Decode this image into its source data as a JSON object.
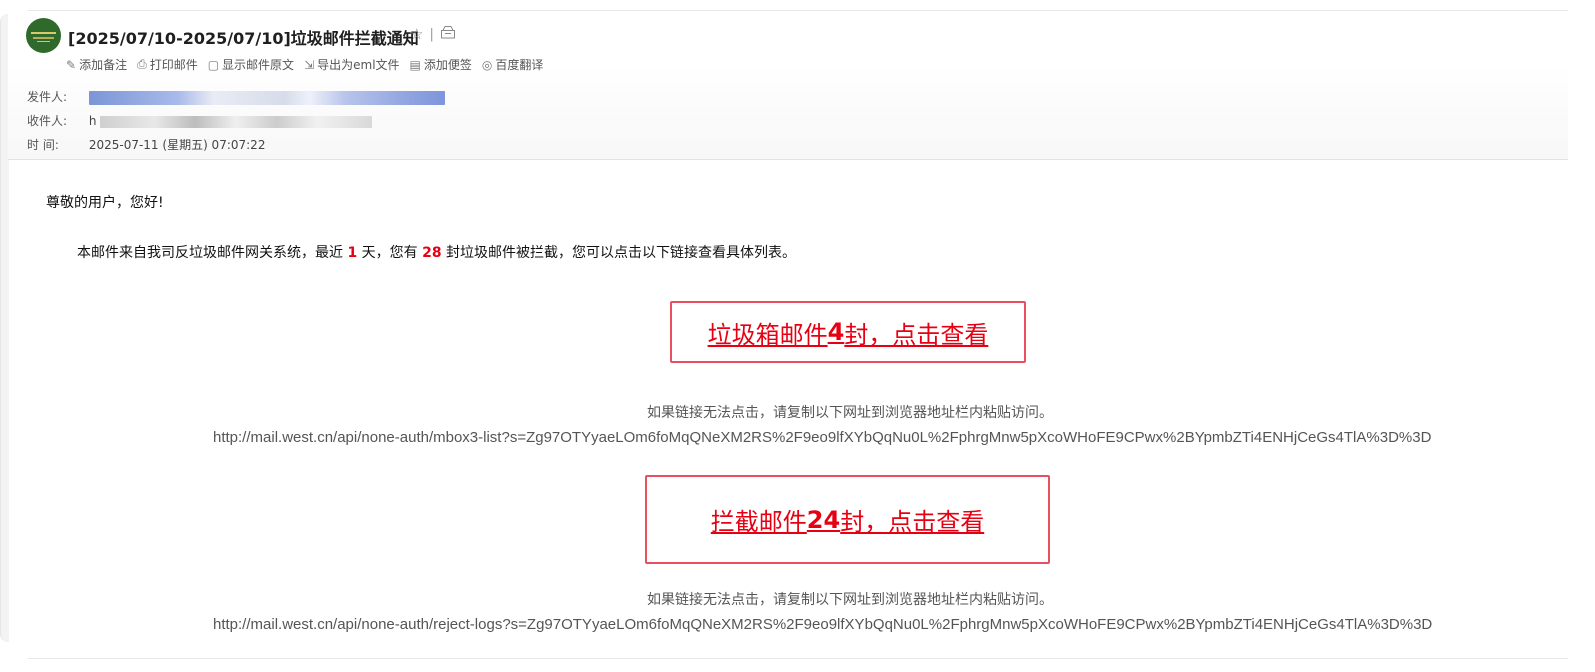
{
  "email": {
    "subject": "[2025/07/10-2025/07/10]垃圾邮件拦截通知",
    "icons": {
      "star": "star-icon",
      "separator": "|",
      "print": "archive-icon"
    },
    "toolbar": [
      {
        "label": "添加备注",
        "icon": "pen-icon"
      },
      {
        "label": "打印邮件",
        "icon": "printer-icon"
      },
      {
        "label": "显示邮件原文",
        "icon": "source-icon"
      },
      {
        "label": "导出为eml文件",
        "icon": "export-icon"
      },
      {
        "label": "添加便签",
        "icon": "note-icon"
      },
      {
        "label": "百度翻译",
        "icon": "translate-icon"
      }
    ],
    "sender_label": "发件人:",
    "recipient_label": "收件人:",
    "recipient_prefix": "h",
    "time_label": "时  间:",
    "time_value": "2025-07-11 (星期五) 07:07:22"
  },
  "body": {
    "greeting": "尊敬的用户，您好!",
    "intro_part1": "本邮件来自我司反垃圾邮件网关系统，最近 ",
    "intro_days": "1",
    "intro_part2": " 天，您有 ",
    "intro_count": "28",
    "intro_part3": " 封垃圾邮件被拦截，您可以点击以下链接查看具体列表。",
    "cta1_prefix": "垃圾箱邮件 ",
    "cta1_count": "4",
    "cta1_suffix": " 封，点击查看",
    "hint1": "如果链接无法点击，请复制以下网址到浏览器地址栏内粘贴访问。",
    "url1": "http://mail.west.cn/api/none-auth/mbox3-list?s=Zg97OTYyaeLOm6foMqQNeXM2RS%2F9eo9lfXYbQqNu0L%2FphrgMnw5pXcoWHoFE9CPwx%2BYpmbZTi4ENHjCeGs4TlA%3D%3D",
    "cta2_prefix": "拦截邮件 ",
    "cta2_count": "24",
    "cta2_suffix": " 封，点击查看",
    "hint2": "如果链接无法点击，请复制以下网址到浏览器地址栏内粘贴访问。",
    "url2": "http://mail.west.cn/api/none-auth/reject-logs?s=Zg97OTYyaeLOm6foMqQNeXM2RS%2F9eo9lfXYbQqNu0L%2FphrgMnw5pXcoWHoFE9CPwx%2BYpmbZTi4ENHjCeGs4TlA%3D%3D"
  },
  "colors": {
    "highlight": "#e60012",
    "cta_border": "#e8505f",
    "avatar": "#2f6a2c"
  }
}
